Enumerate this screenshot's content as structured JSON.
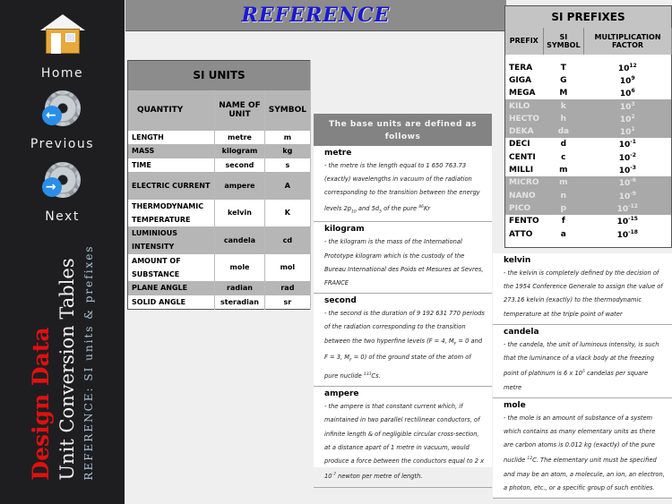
{
  "sidebar": {
    "home": "Home",
    "previous": "Previous",
    "next": "Next",
    "title1": "Design Data",
    "title2": "Unit Conversion Tables",
    "title3": "REFERENCE: SI units & prefixes"
  },
  "colors": {
    "sidebar_bg": "#1e1e20",
    "title_red": "#e01010",
    "header_gray": "#8c8c8c",
    "title_blue": "#1a1acf"
  },
  "header": {
    "title": "REFERENCE"
  },
  "si_units": {
    "title": "SI UNITS",
    "headers": [
      "QUANTITY",
      "NAME OF UNIT",
      "SYMBOL"
    ],
    "rows": [
      {
        "q": "LENGTH",
        "n": "metre",
        "s": "m",
        "shade": false
      },
      {
        "q": "MASS",
        "n": "kilogram",
        "s": "kg",
        "shade": true
      },
      {
        "q": "TIME",
        "n": "second",
        "s": "s",
        "shade": false
      },
      {
        "q": "ELECTRIC CURRENT",
        "n": "ampere",
        "s": "A",
        "shade": true
      },
      {
        "q": "THERMODYNAMIC TEMPERATURE",
        "n": "kelvin",
        "s": "K",
        "shade": false
      },
      {
        "q": "LUMINIOUS INTENSITY",
        "n": "candela",
        "s": "cd",
        "shade": true
      },
      {
        "q": "AMOUNT OF SUBSTANCE",
        "n": "mole",
        "s": "mol",
        "shade": false
      },
      {
        "q": "PLANE ANGLE",
        "n": "radian",
        "s": "rad",
        "shade": true
      },
      {
        "q": "SOLID ANGLE",
        "n": "steradian",
        "s": "sr",
        "shade": false
      }
    ]
  },
  "si_prefixes": {
    "title": "SI PREFIXES",
    "headers": [
      "PREFIX",
      "SI SYMBOL",
      "MULTIPLICATION FACTOR"
    ],
    "rows": [
      {
        "p": "TERA",
        "s": "T",
        "base": "10",
        "exp": "12",
        "shade": false
      },
      {
        "p": "GIGA",
        "s": "G",
        "base": "10",
        "exp": "9",
        "shade": false
      },
      {
        "p": "MEGA",
        "s": "M",
        "base": "10",
        "exp": "6",
        "shade": false
      },
      {
        "p": "KILO",
        "s": "k",
        "base": "10",
        "exp": "3",
        "shade": true
      },
      {
        "p": "HECTO",
        "s": "h",
        "base": "10",
        "exp": "2",
        "shade": true
      },
      {
        "p": "DEKA",
        "s": "da",
        "base": "10",
        "exp": "1",
        "shade": true
      },
      {
        "p": "DECI",
        "s": "d",
        "base": "10",
        "exp": "-1",
        "shade": false
      },
      {
        "p": "CENTI",
        "s": "c",
        "base": "10",
        "exp": "-2",
        "shade": false
      },
      {
        "p": "MILLI",
        "s": "m",
        "base": "10",
        "exp": "-3",
        "shade": false
      },
      {
        "p": "MICRO",
        "s": "m",
        "base": "10",
        "exp": "-6",
        "shade": true
      },
      {
        "p": "NANO",
        "s": "n",
        "base": "10",
        "exp": "-9",
        "shade": true
      },
      {
        "p": "PICO",
        "s": "p",
        "base": "10",
        "exp": "-12",
        "shade": true
      },
      {
        "p": "FENTO",
        "s": "f",
        "base": "10",
        "exp": "-15",
        "shade": false
      },
      {
        "p": "ATTO",
        "s": "a",
        "base": "10",
        "exp": "-18",
        "shade": false
      }
    ]
  },
  "base_units": {
    "heading": "The base units are defined as follows",
    "items": [
      {
        "name": "metre",
        "parts": [
          [
            "",
            "- the metre is the length equal to 1 650 763.73 (exactly) wavelengths in vacuum of the radiation corresponding to the transition between the energy levels 2p"
          ],
          [
            "sub",
            "10"
          ],
          [
            "",
            "  and 5d"
          ],
          [
            "sub",
            "5"
          ],
          [
            "",
            " of the pure "
          ],
          [
            "sup",
            "86"
          ],
          [
            "",
            "Kr"
          ]
        ]
      },
      {
        "name": "kilogram",
        "parts": [
          [
            "",
            "- the kilogram is the mass of the International Prototype kilogram which is the custody of the Bureau International des Poids et Mesures at Sevres, FRANCE"
          ]
        ]
      },
      {
        "name": "second",
        "parts": [
          [
            "",
            "- the second is the duration of 9 192 631 770 periods of the radiation corresponding to the transition between the two hyperfine levels (F = 4, M"
          ],
          [
            "sub",
            "F"
          ],
          [
            "",
            " = 0 and F = 3, M"
          ],
          [
            "sub",
            "F"
          ],
          [
            "",
            " = 0) of the ground state of the atom of pure nuclide "
          ],
          [
            "sup",
            "133"
          ],
          [
            "",
            "Cs."
          ]
        ]
      },
      {
        "name": "ampere",
        "parts": [
          [
            "",
            "- the ampere is that constant current which, if maintained in two parallel rectilinear conductors, of infinite length & of negligible circular cross-section, at a distance apart of 1 metre in vacuum, would produce a force between the conductors equal to 2 x 10"
          ],
          [
            "sup",
            "-7"
          ],
          [
            "",
            " newton per metre of length."
          ]
        ]
      },
      {
        "name": "kelvin",
        "parts": [
          [
            "",
            "- the kelvin is completely defined by the decision of the 1954 Conference Generale to assign the value of 273.16 kelvin (exactly) to the thermodynamic temperature at the triple point of water"
          ]
        ]
      },
      {
        "name": "candela",
        "parts": [
          [
            "",
            "- the candela, the unit of luminous intensity, is such that the luminance of a vlack body at the freezing point of platinum is 6 x 10"
          ],
          [
            "sup",
            "5"
          ],
          [
            "",
            " candelas per square metre"
          ]
        ]
      },
      {
        "name": "mole",
        "parts": [
          [
            "",
            "- the mole is an amount of substance of a system which contains as many elementary units as there are carbon atoms is 0.012 kg (exactly) of the pure nuclide "
          ],
          [
            "sup",
            "12"
          ],
          [
            "",
            "C. The elementary unit must be specified and may be an atom, a molecule, an ion, an electron, a photon, etc., or a specific group of such entities."
          ]
        ]
      }
    ]
  }
}
